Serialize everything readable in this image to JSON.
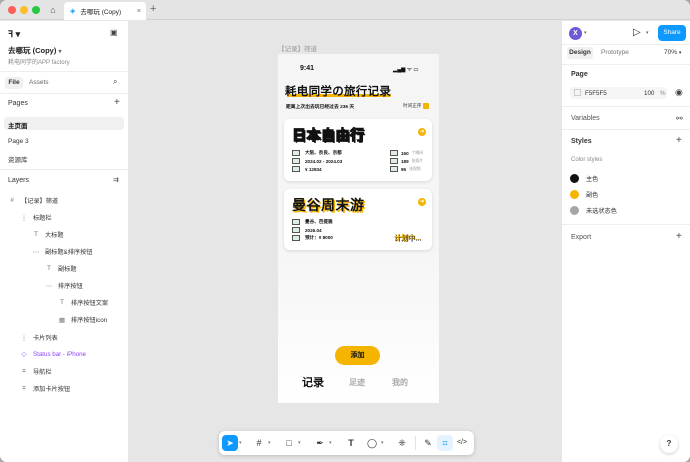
{
  "tab": {
    "title": "去哪玩 (Copy)"
  },
  "file": {
    "name": "去哪玩 (Copy)",
    "project": "耗电同学的APP factory"
  },
  "left_tabs": {
    "file": "File",
    "assets": "Assets"
  },
  "pages": {
    "heading": "Pages",
    "items": [
      "主页面",
      "Page 3",
      "资源库"
    ]
  },
  "layers": {
    "heading": "Layers",
    "items": [
      {
        "label": "【记录】筛道",
        "icon": "#"
      },
      {
        "label": "标题栏",
        "icon": "⋮"
      },
      {
        "label": "大标题",
        "icon": "T"
      },
      {
        "label": "副标题&排序按钮",
        "icon": "⋯"
      },
      {
        "label": "副标题",
        "icon": "T"
      },
      {
        "label": "排序按钮",
        "icon": "⋯"
      },
      {
        "label": "排序按钮文案",
        "icon": "T"
      },
      {
        "label": "排序按钮icon",
        "icon": "▦"
      },
      {
        "label": "卡片列表",
        "icon": "⋮"
      },
      {
        "label": "Status bar - iPhone",
        "icon": "◇"
      },
      {
        "label": "导航栏",
        "icon": "⌗"
      },
      {
        "label": "添加卡片按钮",
        "icon": "⌗"
      }
    ]
  },
  "canvas": {
    "frame_label": "【记录】筛道",
    "status_time": "9:41",
    "status_icons": "▂▄▆ ᯤ ▭",
    "page_title": "耗电同学の旅行记录",
    "subtitle": "距离上次出去玩已经过去 236 天",
    "sort_label": "时间正序",
    "cards": [
      {
        "title": "日本自由行",
        "rows": [
          "大阪、奈良、京都",
          "2024.02 - 2024.03",
          "¥ 12834"
        ],
        "stats": [
          {
            "value": "160",
            "unit": "个瞬间"
          },
          {
            "value": "189",
            "unit": "张照片"
          },
          {
            "value": "95",
            "unit": "张视频"
          }
        ]
      },
      {
        "title": "曼谷周末游",
        "rows": [
          "曼谷、芭提雅",
          "2026.04",
          "预计：¥ 8000"
        ],
        "planning": "计划中..."
      }
    ],
    "add_button": "添加",
    "nav": [
      "记录",
      "足迹",
      "我的"
    ]
  },
  "right": {
    "user_initial": "X",
    "share": "Share",
    "design_tab": "Design",
    "prototype_tab": "Prototype",
    "zoom": "70%",
    "page_heading": "Page",
    "page_color": "F5F5F5",
    "page_opacity": "100",
    "page_opacity_unit": "%",
    "variables": "Variables",
    "styles": "Styles",
    "color_styles": "Color styles",
    "colors": [
      {
        "name": "主色",
        "hex": "#111111"
      },
      {
        "name": "副色",
        "hex": "#F5B400"
      },
      {
        "name": "未选状态色",
        "hex": "#A6A6A6"
      }
    ],
    "export": "Export"
  },
  "help": "?",
  "accent": "#0D99FF"
}
